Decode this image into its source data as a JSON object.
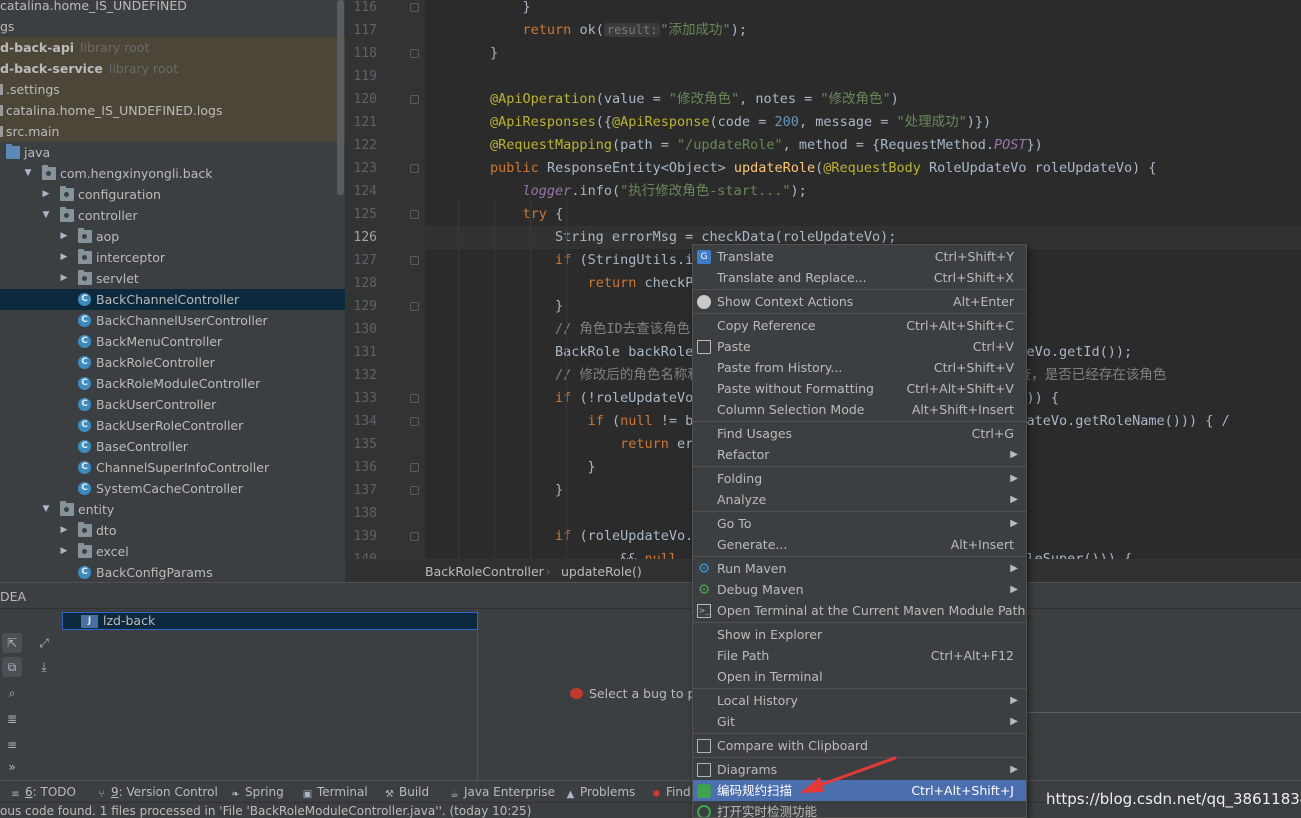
{
  "colors": {
    "tree_bg": "#3c3f41",
    "editor_bg": "#2b2b2b",
    "keyword": "#cc7832",
    "string": "#6a8759",
    "annotation": "#bbb529",
    "number": "#6897bb",
    "method": "#ffc66d",
    "menu_highlight": "#4b6eaf",
    "arrow": "#e53935"
  },
  "tree": {
    "rows": [
      {
        "label": "catalina.home_IS_UNDEFINED",
        "hint": "",
        "indent": -1,
        "icon": "none",
        "arrow": "",
        "kind": ""
      },
      {
        "label": "gs",
        "hint": "",
        "indent": -1,
        "icon": "none",
        "arrow": "",
        "kind": ""
      },
      {
        "label": "d-back-api",
        "hint": "library root",
        "indent": -1,
        "icon": "none",
        "arrow": "",
        "kind": "lib"
      },
      {
        "label": "d-back-service",
        "hint": "library root",
        "indent": -1,
        "icon": "none",
        "arrow": "",
        "kind": "lib"
      },
      {
        "label": ".settings",
        "hint": "",
        "indent": -1,
        "icon": "file",
        "arrow": "",
        "kind": "lib"
      },
      {
        "label": "catalina.home_IS_UNDEFINED.logs",
        "hint": "",
        "indent": -1,
        "icon": "file",
        "arrow": "",
        "kind": "lib"
      },
      {
        "label": "src.main",
        "hint": "",
        "indent": -1,
        "icon": "file",
        "arrow": "",
        "kind": "lib"
      },
      {
        "label": "java",
        "hint": "",
        "indent": 0,
        "icon": "src-folder",
        "arrow": "",
        "kind": ""
      },
      {
        "label": "com.hengxinyongli.back",
        "hint": "",
        "indent": 1,
        "icon": "package",
        "arrow": "▼",
        "kind": ""
      },
      {
        "label": "configuration",
        "hint": "",
        "indent": 2,
        "icon": "package",
        "arrow": "▶",
        "kind": ""
      },
      {
        "label": "controller",
        "hint": "",
        "indent": 2,
        "icon": "package",
        "arrow": "▼",
        "kind": ""
      },
      {
        "label": "aop",
        "hint": "",
        "indent": 3,
        "icon": "package",
        "arrow": "▶",
        "kind": ""
      },
      {
        "label": "interceptor",
        "hint": "",
        "indent": 3,
        "icon": "package",
        "arrow": "▶",
        "kind": ""
      },
      {
        "label": "servlet",
        "hint": "",
        "indent": 3,
        "icon": "package",
        "arrow": "▶",
        "kind": ""
      },
      {
        "label": "BackChannelController",
        "hint": "",
        "indent": 3,
        "icon": "class",
        "arrow": "",
        "kind": "sel"
      },
      {
        "label": "BackChannelUserController",
        "hint": "",
        "indent": 3,
        "icon": "class",
        "arrow": "",
        "kind": ""
      },
      {
        "label": "BackMenuController",
        "hint": "",
        "indent": 3,
        "icon": "class",
        "arrow": "",
        "kind": ""
      },
      {
        "label": "BackRoleController",
        "hint": "",
        "indent": 3,
        "icon": "class",
        "arrow": "",
        "kind": ""
      },
      {
        "label": "BackRoleModuleController",
        "hint": "",
        "indent": 3,
        "icon": "class",
        "arrow": "",
        "kind": ""
      },
      {
        "label": "BackUserController",
        "hint": "",
        "indent": 3,
        "icon": "class",
        "arrow": "",
        "kind": ""
      },
      {
        "label": "BackUserRoleController",
        "hint": "",
        "indent": 3,
        "icon": "class",
        "arrow": "",
        "kind": ""
      },
      {
        "label": "BaseController",
        "hint": "",
        "indent": 3,
        "icon": "class",
        "arrow": "",
        "kind": ""
      },
      {
        "label": "ChannelSuperInfoController",
        "hint": "",
        "indent": 3,
        "icon": "class",
        "arrow": "",
        "kind": ""
      },
      {
        "label": "SystemCacheController",
        "hint": "",
        "indent": 3,
        "icon": "class",
        "arrow": "",
        "kind": ""
      },
      {
        "label": "entity",
        "hint": "",
        "indent": 2,
        "icon": "package",
        "arrow": "▼",
        "kind": ""
      },
      {
        "label": "dto",
        "hint": "",
        "indent": 3,
        "icon": "package",
        "arrow": "▶",
        "kind": ""
      },
      {
        "label": "excel",
        "hint": "",
        "indent": 3,
        "icon": "package",
        "arrow": "▶",
        "kind": ""
      },
      {
        "label": "BackConfigParams",
        "hint": "",
        "indent": 3,
        "icon": "class",
        "arrow": "",
        "kind": ""
      }
    ]
  },
  "editor": {
    "current_line": 126,
    "lines": [
      {
        "num": "116",
        "tokens": [
          [
            "",
            "            "
          ],
          [
            "",
            "}"
          ]
        ]
      },
      {
        "num": "117",
        "tokens": [
          [
            "",
            "            "
          ],
          [
            "k",
            "return "
          ],
          [
            "",
            "ok("
          ],
          [
            "hint",
            "result:"
          ],
          [
            "s",
            "\"添加成功\""
          ],
          [
            "",
            ");"
          ]
        ]
      },
      {
        "num": "118",
        "tokens": [
          [
            "",
            "        }"
          ]
        ]
      },
      {
        "num": "119",
        "tokens": []
      },
      {
        "num": "120",
        "tokens": [
          [
            "",
            "        "
          ],
          [
            "a",
            "@ApiOperation"
          ],
          [
            "",
            "(value = "
          ],
          [
            "s",
            "\"修改角色\""
          ],
          [
            "",
            ", notes = "
          ],
          [
            "s",
            "\"修改角色\""
          ],
          [
            "",
            ")"
          ]
        ]
      },
      {
        "num": "121",
        "tokens": [
          [
            "",
            "        "
          ],
          [
            "a",
            "@ApiResponses"
          ],
          [
            "",
            "({"
          ],
          [
            "a",
            "@ApiResponse"
          ],
          [
            "",
            "(code = "
          ],
          [
            "n",
            "200"
          ],
          [
            "",
            ", message = "
          ],
          [
            "s",
            "\"处理成功\""
          ],
          [
            "",
            ")})"
          ]
        ]
      },
      {
        "num": "122",
        "tokens": [
          [
            "",
            "        "
          ],
          [
            "a",
            "@RequestMapping"
          ],
          [
            "",
            "(path = "
          ],
          [
            "s",
            "\"/updateRole\""
          ],
          [
            "",
            ", method = {RequestMethod."
          ],
          [
            "it",
            "POST"
          ],
          [
            "",
            "})"
          ]
        ]
      },
      {
        "num": "123",
        "tokens": [
          [
            "",
            "        "
          ],
          [
            "k",
            "public "
          ],
          [
            "",
            "ResponseEntity<Object> "
          ],
          [
            "f",
            "updateRole"
          ],
          [
            "",
            "("
          ],
          [
            "a",
            "@RequestBody "
          ],
          [
            "",
            "RoleUpdateVo roleUpdateVo) {"
          ]
        ]
      },
      {
        "num": "124",
        "tokens": [
          [
            "",
            "            "
          ],
          [
            "it",
            "logger"
          ],
          [
            "",
            ".info("
          ],
          [
            "s",
            "\"执行修改角色-start...\""
          ],
          [
            "",
            ");"
          ]
        ]
      },
      {
        "num": "125",
        "tokens": [
          [
            "",
            "            "
          ],
          [
            "k",
            "try "
          ],
          [
            "",
            "{"
          ]
        ]
      },
      {
        "num": "126",
        "tokens": [
          [
            "",
            "                String errorMsg = checkData(roleUpdateVo);"
          ]
        ]
      },
      {
        "num": "127",
        "tokens": [
          [
            "",
            "                "
          ],
          [
            "k",
            "if "
          ],
          [
            "",
            "(StringUtils.is"
          ]
        ]
      },
      {
        "num": "128",
        "tokens": [
          [
            "",
            "                    "
          ],
          [
            "k",
            "return "
          ],
          [
            "",
            "checkPa"
          ]
        ]
      },
      {
        "num": "129",
        "tokens": [
          [
            "",
            "                }"
          ]
        ]
      },
      {
        "num": "130",
        "tokens": [
          [
            "",
            "                "
          ],
          [
            "c",
            "// 角色ID去查该角色"
          ]
        ]
      },
      {
        "num": "131",
        "tokens": [
          [
            "",
            "                BackRole backRole                                  leUpdateVo.getId());"
          ]
        ]
      },
      {
        "num": "132",
        "tokens": [
          [
            "",
            "                "
          ],
          [
            "c",
            "// 修改后的角色名称和                                  名称去查，是否已经存在该角色"
          ]
        ]
      },
      {
        "num": "133",
        "tokens": [
          [
            "",
            "                "
          ],
          [
            "k",
            "if "
          ],
          [
            "",
            "(!roleUpdateVo.                                  Name())) {"
          ]
        ]
      },
      {
        "num": "134",
        "tokens": [
          [
            "",
            "                    "
          ],
          [
            "k",
            "if "
          ],
          [
            "",
            "("
          ],
          [
            "k",
            "null "
          ],
          [
            "",
            "!= ba                                  oleUpdateVo.getRoleName())) { /"
          ]
        ]
      },
      {
        "num": "135",
        "tokens": [
          [
            "",
            "                        "
          ],
          [
            "k",
            "return "
          ],
          [
            "",
            "err"
          ]
        ]
      },
      {
        "num": "136",
        "tokens": [
          [
            "",
            "                    }"
          ]
        ]
      },
      {
        "num": "137",
        "tokens": [
          [
            "",
            "                }"
          ]
        ]
      },
      {
        "num": "138",
        "tokens": []
      },
      {
        "num": "139",
        "tokens": [
          [
            "",
            "                "
          ],
          [
            "k",
            "if "
          ],
          [
            "",
            "(roleUpdateVo.g"
          ]
        ]
      },
      {
        "num": "140",
        "tokens": [
          [
            "",
            "                        && "
          ],
          [
            "k",
            "null"
          ],
          [
            "",
            "                             UpdateVo.getRoleSuper())) {"
          ]
        ]
      }
    ]
  },
  "breadcrumbs": [
    "BackRoleController",
    "updateRole()"
  ],
  "panel": {
    "title": "DEA",
    "result_item": "lzd-back",
    "bug_hint": "Select a bug to p"
  },
  "toolstrip": [
    {
      "icon": "todo-icon",
      "glyph": "≡",
      "mnemonic": "6",
      "label": ": TODO"
    },
    {
      "icon": "version-control-icon",
      "glyph": "⑂",
      "mnemonic": "9",
      "label": ": Version Control"
    },
    {
      "icon": "spring-icon",
      "glyph": "❧",
      "mnemonic": "",
      "label": "Spring"
    },
    {
      "icon": "terminal-icon",
      "glyph": "▣",
      "mnemonic": "",
      "label": "Terminal"
    },
    {
      "icon": "build-icon",
      "glyph": "⚒",
      "mnemonic": "",
      "label": "Build"
    },
    {
      "icon": "java-enterprise-icon",
      "glyph": "☕",
      "mnemonic": "",
      "label": "Java Enterprise"
    },
    {
      "icon": "problems-icon",
      "glyph": "▲",
      "mnemonic": "",
      "label": "Problems"
    },
    {
      "icon": "find-bugs-icon",
      "glyph": "✱",
      "mnemonic": "",
      "label": "Find"
    }
  ],
  "status": {
    "message": "ous code found. 1 files processed in 'File 'BackRoleModuleController.java''. (today 10:25)"
  },
  "context_menu": {
    "items": [
      {
        "type": "item",
        "label": "Translate",
        "shortcut": "Ctrl+Shift+Y",
        "icon": "translate",
        "sub": false
      },
      {
        "type": "item",
        "label": "Translate and Replace...",
        "shortcut": "Ctrl+Shift+X",
        "icon": "",
        "sub": false
      },
      {
        "type": "sep"
      },
      {
        "type": "item",
        "label": "Show Context Actions",
        "shortcut": "Alt+Enter",
        "icon": "ctx",
        "sub": false
      },
      {
        "type": "sep"
      },
      {
        "type": "item",
        "label": "Copy Reference",
        "shortcut": "Ctrl+Alt+Shift+C",
        "icon": "",
        "sub": false
      },
      {
        "type": "item",
        "label": "Paste",
        "shortcut": "Ctrl+V",
        "icon": "paste",
        "sub": false
      },
      {
        "type": "item",
        "label": "Paste from History...",
        "shortcut": "Ctrl+Shift+V",
        "icon": "",
        "sub": false
      },
      {
        "type": "item",
        "label": "Paste without Formatting",
        "shortcut": "Ctrl+Alt+Shift+V",
        "icon": "",
        "sub": false
      },
      {
        "type": "item",
        "label": "Column Selection Mode",
        "shortcut": "Alt+Shift+Insert",
        "icon": "",
        "sub": false
      },
      {
        "type": "sep"
      },
      {
        "type": "item",
        "label": "Find Usages",
        "shortcut": "Ctrl+G",
        "icon": "",
        "sub": false
      },
      {
        "type": "item",
        "label": "Refactor",
        "shortcut": "",
        "icon": "",
        "sub": true
      },
      {
        "type": "sep"
      },
      {
        "type": "item",
        "label": "Folding",
        "shortcut": "",
        "icon": "",
        "sub": true
      },
      {
        "type": "item",
        "label": "Analyze",
        "shortcut": "",
        "icon": "",
        "sub": true
      },
      {
        "type": "sep"
      },
      {
        "type": "item",
        "label": "Go To",
        "shortcut": "",
        "icon": "",
        "sub": true
      },
      {
        "type": "item",
        "label": "Generate...",
        "shortcut": "Alt+Insert",
        "icon": "",
        "sub": false
      },
      {
        "type": "sep"
      },
      {
        "type": "item",
        "label": "Run Maven",
        "shortcut": "",
        "icon": "maven",
        "sub": true
      },
      {
        "type": "item",
        "label": "Debug Maven",
        "shortcut": "",
        "icon": "debug",
        "sub": true
      },
      {
        "type": "item",
        "label": "Open Terminal at the Current Maven Module Path",
        "shortcut": "",
        "icon": "term",
        "sub": false
      },
      {
        "type": "sep"
      },
      {
        "type": "item",
        "label": "Show in Explorer",
        "shortcut": "",
        "icon": "",
        "sub": false
      },
      {
        "type": "item",
        "label": "File Path",
        "shortcut": "Ctrl+Alt+F12",
        "icon": "",
        "sub": false
      },
      {
        "type": "item",
        "label": "Open in Terminal",
        "shortcut": "",
        "icon": "",
        "sub": false
      },
      {
        "type": "sep"
      },
      {
        "type": "item",
        "label": "Local History",
        "shortcut": "",
        "icon": "",
        "sub": true
      },
      {
        "type": "item",
        "label": "Git",
        "shortcut": "",
        "icon": "",
        "sub": true
      },
      {
        "type": "sep"
      },
      {
        "type": "item",
        "label": "Compare with Clipboard",
        "shortcut": "",
        "icon": "compare",
        "sub": false
      },
      {
        "type": "sep"
      },
      {
        "type": "item",
        "label": "Diagrams",
        "shortcut": "",
        "icon": "diagram",
        "sub": true
      },
      {
        "type": "item",
        "label": "编码规约扫描",
        "shortcut": "Ctrl+Alt+Shift+J",
        "icon": "scan",
        "sub": false,
        "highlight": true
      },
      {
        "type": "item",
        "label": "打开实时检测功能",
        "shortcut": "",
        "icon": "live",
        "sub": false
      }
    ]
  },
  "watermark": "https://blog.csdn.net/qq_38611834"
}
